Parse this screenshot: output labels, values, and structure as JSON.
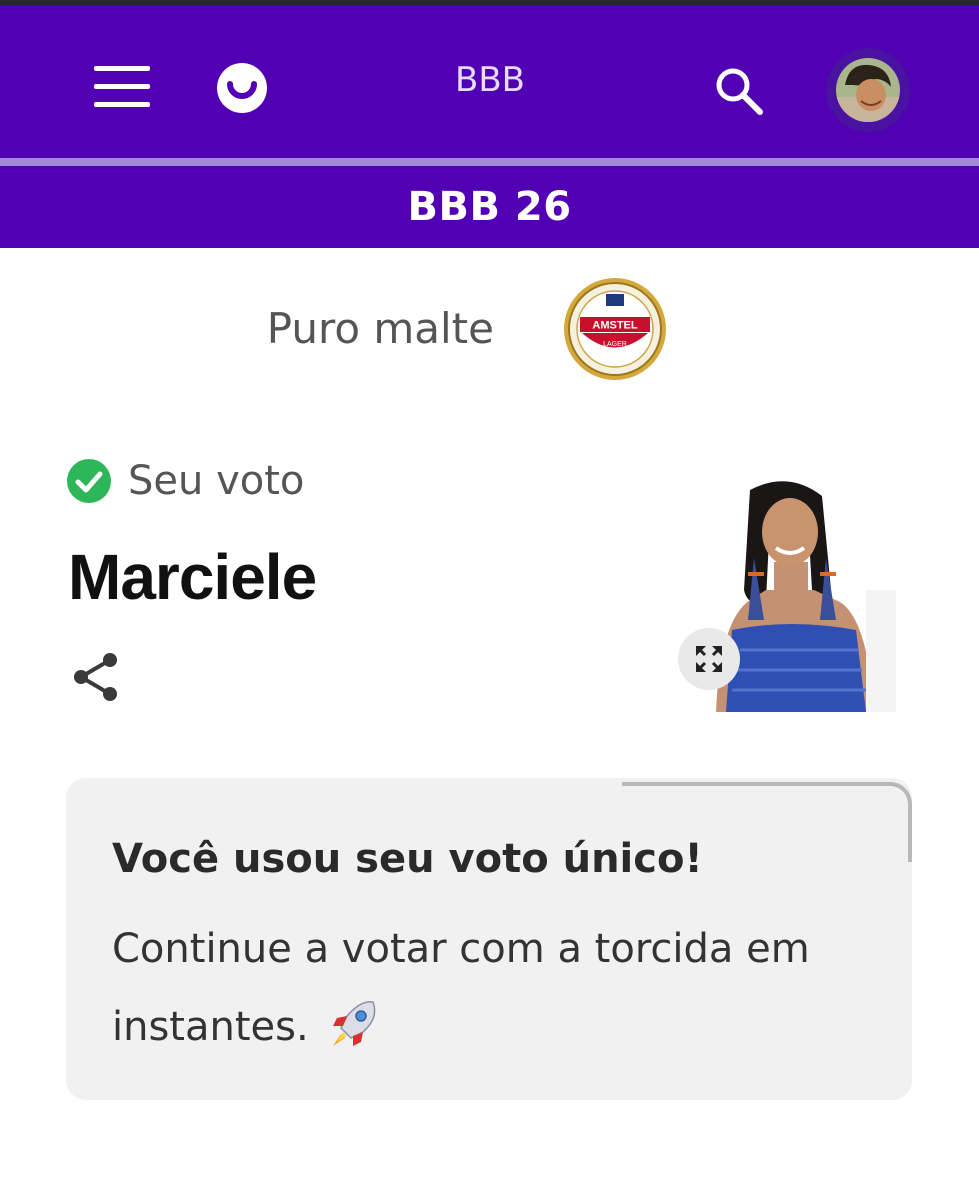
{
  "header": {
    "app_title": "BBB",
    "section_title": "BBB 26"
  },
  "sponsor": {
    "tagline": "Puro malte",
    "brand_name": "AMSTEL",
    "brand_sub": "LAGER"
  },
  "vote": {
    "label": "Seu voto",
    "candidate_name": "Marciele"
  },
  "message": {
    "title": "Você usou seu voto único!",
    "body": "Continue a votar com a torcida em instantes.",
    "emoji": "rocket-icon"
  },
  "colors": {
    "brand_purple": "#5200b4",
    "success_green": "#2db75a",
    "card_bg": "#f1f1f1"
  }
}
